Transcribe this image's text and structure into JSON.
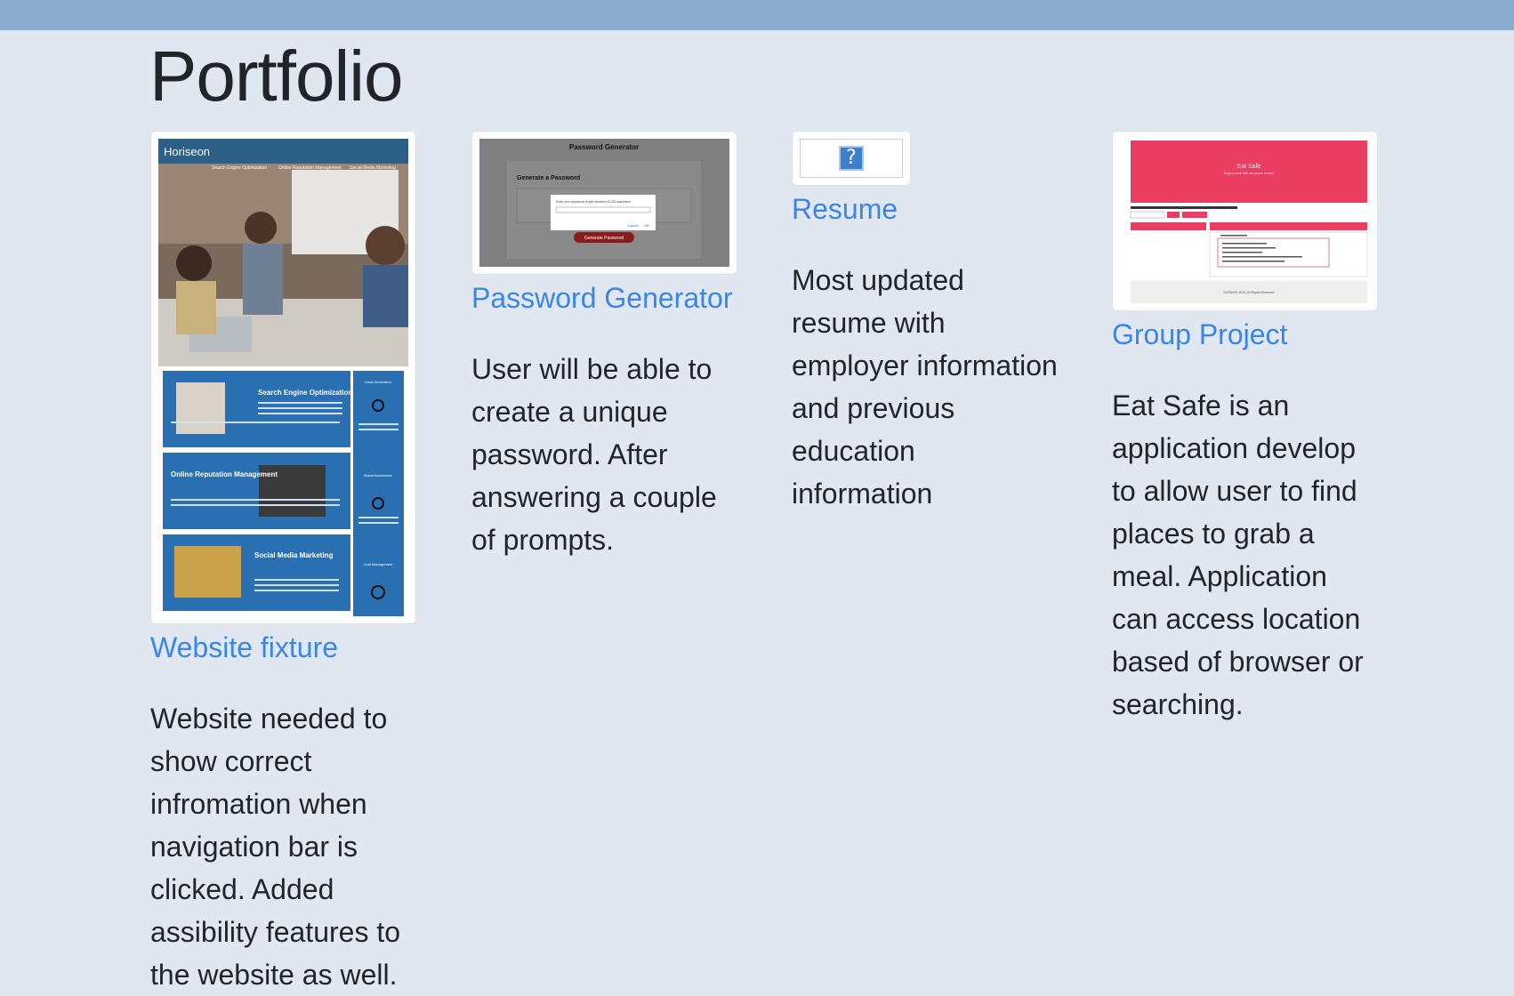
{
  "page": {
    "title": "Portfolio"
  },
  "projects": [
    {
      "link": "Website fixture",
      "description": "Website needed to show correct infromation when navigation bar is clicked. Added assibility features to the website as well.",
      "thumb": {
        "brand": "Horiseon",
        "nav": [
          "Search Engine Optimization",
          "Online Reputation Management",
          "Social Media Marketing"
        ],
        "sections": [
          "Search Engine Optimization",
          "Online Reputation Management",
          "Social Media Marketing"
        ],
        "side": [
          "Lead Generation",
          "Brand Awareness",
          "Cost Management"
        ]
      }
    },
    {
      "link": "Password Generator",
      "description": "User will be able to create a unique password. After answering a couple of prompts.",
      "thumb": {
        "title": "Password Generator",
        "heading": "Generate a Password",
        "dialog_text": "Enter your password length between 8-128 characters",
        "cancel": "Cancel",
        "ok": "OK",
        "button": "Generate Password"
      }
    },
    {
      "link": "Resume",
      "description": "Most updated resume with employer information and previous education information",
      "thumb": {
        "placeholder_glyph": "?"
      }
    },
    {
      "link": "Group Project",
      "description": "Eat Safe is an application develop to allow user to find places to grab a meal. Application can access location based of browser or searching.",
      "thumb": {
        "title": "Eat Safe",
        "subtitle": "Enjoy a meal with our peace of mind",
        "footer": "EATSAFE 2020, All Rights Reserved"
      }
    }
  ],
  "colors": {
    "accent": "#3a86e6",
    "topbar": "#8aaccc",
    "background": "#e1e7f0",
    "eat_safe": "#e93d62",
    "horiseon": "#2a6fb2"
  }
}
